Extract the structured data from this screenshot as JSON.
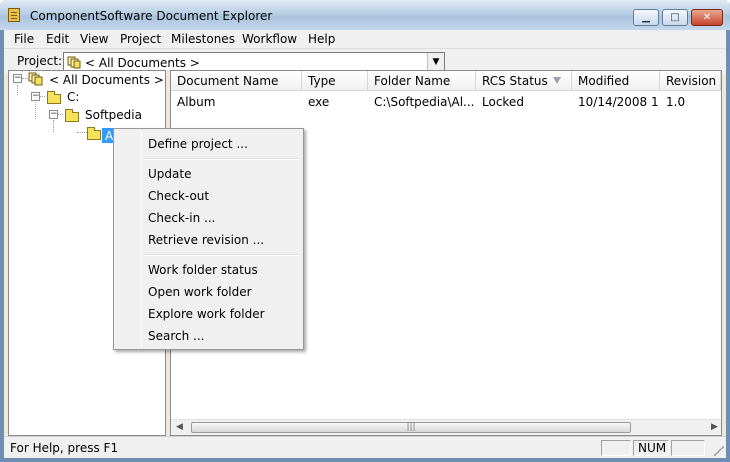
{
  "window": {
    "title": "ComponentSoftware Document Explorer",
    "minimize_glyph": "▁",
    "maximize_glyph": "□",
    "close_glyph": "✕"
  },
  "menu": {
    "items": [
      "File",
      "Edit",
      "View",
      "Project",
      "Milestones",
      "Workflow",
      "Help"
    ]
  },
  "project": {
    "label": "Project:",
    "selected": "< All Documents >",
    "arrow": "▼"
  },
  "tree": {
    "root": "< All Documents >",
    "drive": "C:",
    "folder": "Softpedia",
    "selected_folder": "A",
    "collapse_glyph": "−"
  },
  "list": {
    "columns": [
      "Document Name",
      "Type",
      "Folder Name",
      "RCS Status",
      "Modified",
      "Revision"
    ],
    "rows": [
      [
        "Album",
        "exe",
        "C:\\Softpedia\\Al...",
        "Locked",
        "10/14/2008 1...",
        "1.0"
      ]
    ],
    "scroll_left": "◀",
    "scroll_right": "▶",
    "thumb_grip": "|||"
  },
  "context_menu": {
    "items": [
      "Define project ...",
      "Update",
      "Check-out",
      "Check-in ...",
      "Retrieve revision ...",
      "Work folder status",
      "Open work folder",
      "Explore work folder",
      "Search ..."
    ]
  },
  "status": {
    "help_text": "For Help, press F1",
    "num": "NUM"
  },
  "colors": {
    "selection": "#3399ff",
    "folder": "#f6e25a",
    "frame": "#6e8fb3"
  },
  "icons": [
    "app-icon",
    "documents-icon",
    "folder-icon",
    "open-folder-icon",
    "filter-icon",
    "chevron-down-icon",
    "size-grip-icon"
  ]
}
